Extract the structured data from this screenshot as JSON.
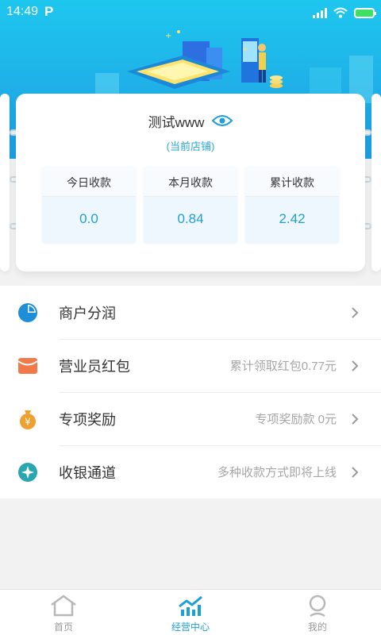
{
  "status_bar": {
    "time": "14:49",
    "app_badge": "P"
  },
  "shop": {
    "name": "测试www",
    "subtitle": "(当前店铺)"
  },
  "stats": [
    {
      "label": "今日收款",
      "value": "0.0"
    },
    {
      "label": "本月收款",
      "value": "0.84"
    },
    {
      "label": "累计收款",
      "value": "2.42"
    }
  ],
  "menu": [
    {
      "label": "商户分润",
      "detail": "",
      "icon": "pie-chart-icon",
      "color": "#1e8fd6"
    },
    {
      "label": "营业员红包",
      "detail": "累计领取红包0.77元",
      "icon": "red-envelope-icon",
      "color": "#f07a4a"
    },
    {
      "label": "专项奖励",
      "detail": "专项奖励款  0元",
      "icon": "money-bag-icon",
      "color": "#f0a030"
    },
    {
      "label": "收银通道",
      "detail": "多种收款方式即将上线",
      "icon": "compass-icon",
      "color": "#2aa6b0"
    }
  ],
  "tabs": [
    {
      "label": "首页",
      "icon": "home-icon",
      "active": false
    },
    {
      "label": "经营中心",
      "icon": "chart-icon",
      "active": true
    },
    {
      "label": "我的",
      "icon": "profile-icon",
      "active": false
    }
  ],
  "colors": {
    "accent": "#1e9fd6",
    "banner": "#1fb0e8"
  }
}
